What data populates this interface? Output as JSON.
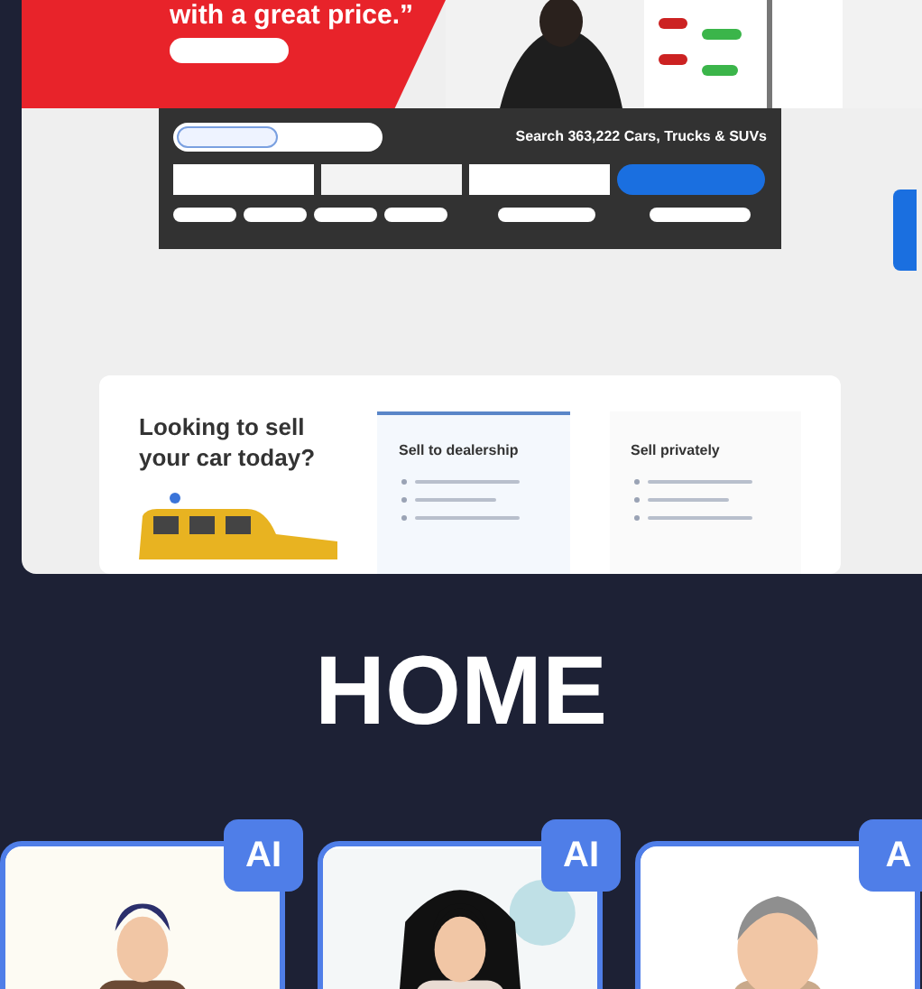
{
  "hero": {
    "headline": "with a great price.”"
  },
  "search_panel": {
    "title": "Search 363,222 Cars, Trucks & SUVs"
  },
  "sell_card": {
    "title": "Looking to sell your car today?",
    "options": [
      {
        "title": "Sell to dealership",
        "selected": true
      },
      {
        "title": "Sell privately",
        "selected": false
      }
    ]
  },
  "heading": "HOME",
  "avatars": [
    {
      "badge": "AI",
      "kind": "man"
    },
    {
      "badge": "AI",
      "kind": "woman"
    },
    {
      "badge": "A",
      "kind": "elder"
    }
  ]
}
